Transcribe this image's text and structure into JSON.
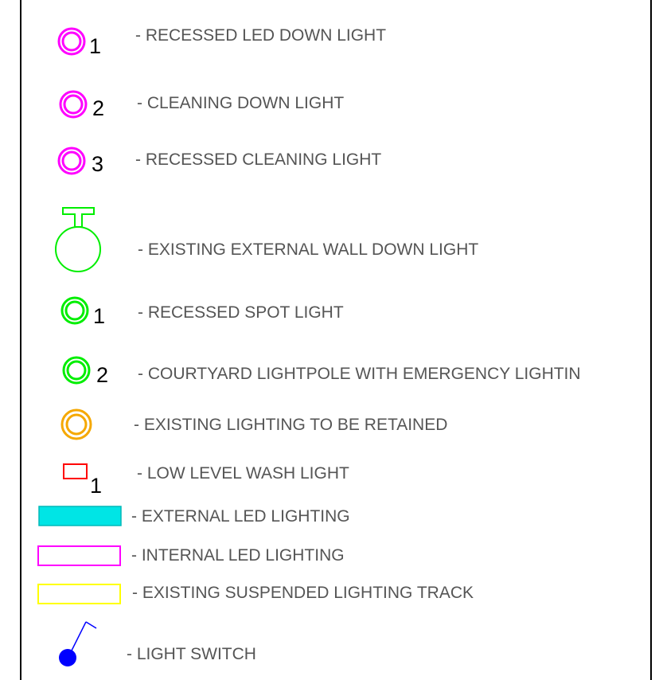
{
  "legend": {
    "items": [
      {
        "symbol": "magenta-double-ring-icon",
        "number": "1",
        "label": "- RECESSED LED DOWN LIGHT"
      },
      {
        "symbol": "magenta-double-ring-icon",
        "number": "2",
        "label": "- CLEANING DOWN LIGHT"
      },
      {
        "symbol": "magenta-double-ring-icon",
        "number": "3",
        "label": "- RECESSED CLEANING LIGHT"
      },
      {
        "symbol": "wall-light-icon",
        "label": "- EXISTING EXTERNAL WALL DOWN LIGHT"
      },
      {
        "symbol": "green-double-ring-icon",
        "number": "1",
        "label": "- RECESSED SPOT LIGHT"
      },
      {
        "symbol": "green-double-ring-icon",
        "number": "2",
        "label": "- COURTYARD LIGHTPOLE WITH EMERGENCY LIGHTIN"
      },
      {
        "symbol": "orange-double-ring-icon",
        "label": "- EXISTING LIGHTING TO BE RETAINED"
      },
      {
        "symbol": "red-rectangle-icon",
        "number": "1",
        "label": "- LOW LEVEL WASH LIGHT"
      },
      {
        "symbol": "cyan-filled-bar-icon",
        "label": "- EXTERNAL LED LIGHTING"
      },
      {
        "symbol": "magenta-outline-bar-icon",
        "label": "- INTERNAL LED LIGHTING"
      },
      {
        "symbol": "yellow-outline-bar-icon",
        "label": "- EXISTING SUSPENDED LIGHTING TRACK"
      },
      {
        "symbol": "light-switch-icon",
        "label": "- LIGHT SWITCH"
      }
    ]
  },
  "colors": {
    "magenta": "#ff00ff",
    "green": "#00ee00",
    "orange": "#f5a800",
    "red": "#ff0000",
    "cyan": "#00e5e5",
    "yellow": "#ffff00",
    "blue": "#0000ff",
    "label_gray": "#555555",
    "border": "#000000"
  }
}
